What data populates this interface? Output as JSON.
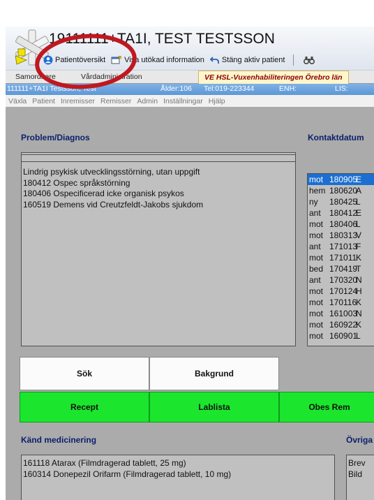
{
  "window": {
    "patient_title": "19111111+TA1I, TEST TESTSSON"
  },
  "toolbar": {
    "items": [
      {
        "label": "Patientöversikt",
        "icon": "user-icon"
      },
      {
        "label": "Visa utökad information",
        "icon": "info-window-icon"
      },
      {
        "label": "Stäng aktiv patient",
        "icon": "undo-icon"
      }
    ],
    "search_icon": "binoculars-icon"
  },
  "tabs": {
    "items": [
      "Samordnare",
      "Vårdadministration",
      "VE HSL-Vuxenhabiliteringen Örebro län"
    ],
    "active": 2
  },
  "infobar": {
    "patient": "111111+TA1I Testsson, Test",
    "age": "Ålder:106",
    "phone": "Tel:019-223344",
    "enh": "ENH:",
    "lis": "LIS:"
  },
  "menubar": {
    "items": [
      "Växla",
      "Patient",
      "Inremisser",
      "Remisser",
      "Admin",
      "Inställningar",
      "Hjälp"
    ]
  },
  "problem": {
    "title": "Problem/Diagnos",
    "items": [
      "Lindrig psykisk utvecklingsstörning, utan uppgift",
      "180412 Ospec språkstörning",
      "180406 Ospecificerad icke organisk psykos",
      "160519 Demens vid Creutzfeldt-Jakobs sjukdom"
    ]
  },
  "contact": {
    "title": "Kontaktdatum",
    "rows": [
      {
        "type": "mot",
        "date": "180905",
        "c": "E"
      },
      {
        "type": "hem",
        "date": "180620",
        "c": "A"
      },
      {
        "type": "ny",
        "date": "180425",
        "c": "L"
      },
      {
        "type": "ant",
        "date": "180412",
        "c": "E"
      },
      {
        "type": "mot",
        "date": "180406",
        "c": "L"
      },
      {
        "type": "mot",
        "date": "180313",
        "c": "V"
      },
      {
        "type": "ant",
        "date": "171013",
        "c": "F"
      },
      {
        "type": "mot",
        "date": "171011",
        "c": "K"
      },
      {
        "type": "bed",
        "date": "170419",
        "c": "T"
      },
      {
        "type": "ant",
        "date": "170320",
        "c": "N"
      },
      {
        "type": "mot",
        "date": "170124",
        "c": "H"
      },
      {
        "type": "mot",
        "date": "170116",
        "c": "K"
      },
      {
        "type": "mot",
        "date": "161003",
        "c": "N"
      },
      {
        "type": "mot",
        "date": "160922",
        "c": "K"
      },
      {
        "type": "mot",
        "date": "160901",
        "c": "L"
      }
    ],
    "selected": 0
  },
  "buttons": {
    "sok": "Sök",
    "bakgrund": "Bakgrund",
    "recept": "Recept",
    "lablista": "Lablista",
    "obesrem": "Obes Rem"
  },
  "medication": {
    "title": "Känd medicinering",
    "items": [
      "161118 Atarax (Filmdragerad tablett, 25 mg)",
      "160314 Donepezil Orifarm (Filmdragerad tablett, 10 mg)"
    ]
  },
  "other": {
    "title": "Övriga",
    "items": [
      "Brev",
      "Bild"
    ]
  },
  "colors": {
    "section_title": "#0b1f6b",
    "green_button": "#1be62d",
    "selection": "#1c6fd0",
    "annotation_circle": "#c01820"
  }
}
